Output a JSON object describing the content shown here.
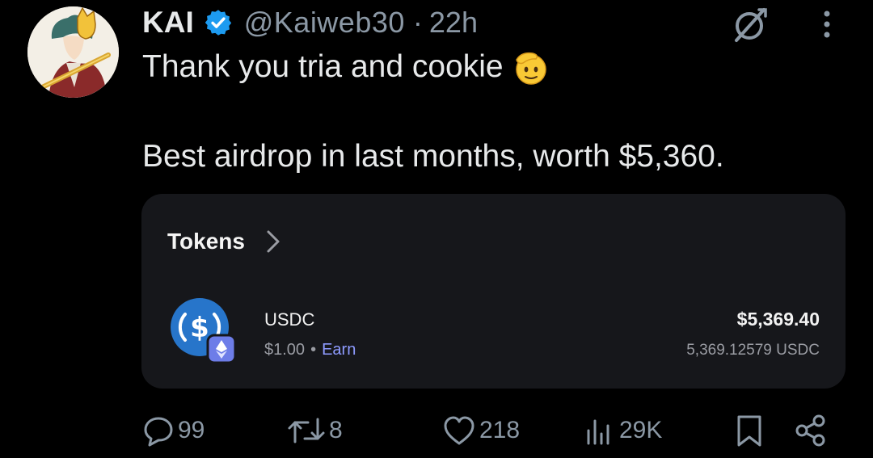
{
  "author": {
    "name": "KAI",
    "handle": "@Kaiweb30",
    "separator": "·",
    "time": "22h"
  },
  "tweet": {
    "line1": "Thank you tria and cookie",
    "line1_emoji": "saluting-face-emoji",
    "line2": "Best airdrop in last months, worth $5,360."
  },
  "card": {
    "title": "Tokens",
    "token": {
      "name": "USDC",
      "price": "$1.00",
      "bullet": "•",
      "earn_label": "Earn",
      "value": "$5,369.40",
      "amount": "5,369.12579 USDC"
    }
  },
  "actions": {
    "replies": "99",
    "reposts": "8",
    "likes": "218",
    "views": "29K"
  },
  "colors": {
    "background": "#000000",
    "text": "#e7e9ea",
    "muted": "#8b98a5",
    "verified": "#1d9bf0",
    "card": "#16171b",
    "usdc": "#2775ca",
    "earn": "#8e9bff"
  },
  "icons": [
    "verified-badge-icon",
    "grok-icon",
    "more-icon",
    "chevron-right-icon",
    "usdc-icon",
    "ethereum-badge-icon",
    "reply-icon",
    "repost-icon",
    "like-icon",
    "views-icon",
    "bookmark-icon",
    "share-icon"
  ]
}
